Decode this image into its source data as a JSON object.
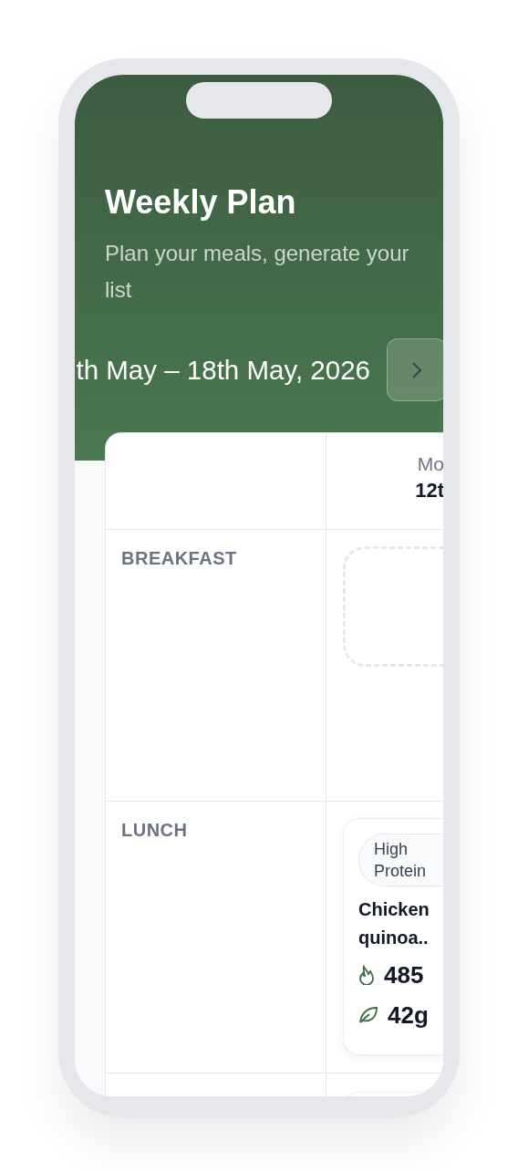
{
  "header": {
    "title": "Weekly Plan",
    "subtitle": "Plan your meals, generate your list",
    "week_range": "th May – 18th May, 2026"
  },
  "table": {
    "columns": [
      {
        "day": "Mo",
        "date": "12t"
      }
    ],
    "rows": [
      {
        "label": "BREAKFAST",
        "cells": [
          {
            "kind": "empty"
          }
        ]
      },
      {
        "label": "LUNCH",
        "cells": [
          {
            "kind": "meal",
            "tag": "High Protein",
            "name": "Chicken quinoa..",
            "calories": "485",
            "protein": "42g"
          }
        ]
      },
      {
        "cells": [
          {
            "kind": "partial"
          }
        ]
      }
    ]
  }
}
